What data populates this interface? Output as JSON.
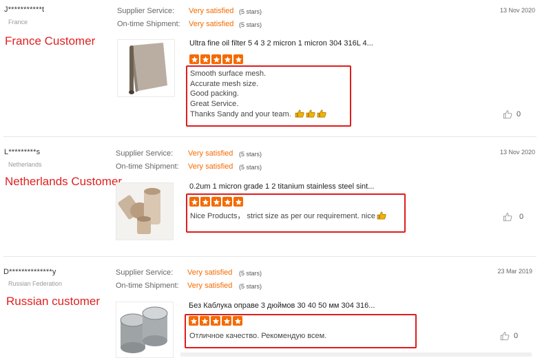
{
  "labels": {
    "supplier_service": "Supplier Service:",
    "ontime_shipment": "On-time Shipment:"
  },
  "reviews": [
    {
      "buyer": "J***********t",
      "country": "France",
      "tag": "France Customer",
      "supplier_value": "Very satisfied",
      "supplier_stars": "(5 stars)",
      "shipment_value": "Very satisfied",
      "shipment_stars": "(5 stars)",
      "date": "13 Nov 2020",
      "product": "Ultra fine oil filter 5 4 3 2 micron 1 micron 304 316L 4...",
      "rating": 5,
      "comment_lines": [
        "Smooth surface mesh.",
        "Accurate mesh size.",
        "Good packing.",
        "Great Service.",
        "Thanks Sandy and your team."
      ],
      "thumbs": 3,
      "likes": "0"
    },
    {
      "buyer": "L*********s",
      "country": "Netherlands",
      "tag": "Netherlands Customer",
      "supplier_value": "Very satisfied",
      "supplier_stars": "(5 stars)",
      "shipment_value": "Very satisfied",
      "shipment_stars": "(5 stars)",
      "date": "13 Nov 2020",
      "product": "0.2um 1 micron grade 1 2 titanium stainless steel sint...",
      "rating": 5,
      "comment_lines": [
        "Nice Products，   strict size as per our requirement. nice"
      ],
      "thumbs": 1,
      "likes": "0"
    },
    {
      "buyer": "D**************y",
      "country": "Russian Federation",
      "tag": "Russian customer",
      "supplier_value": "Very satisfied",
      "supplier_stars": "(5 stars)",
      "shipment_value": "Very satisfied",
      "shipment_stars": "(5 stars)",
      "date": "23 Mar 2019",
      "product": "Без Каблука оправе 3 дюймов 30 40 50 мм 304 316...",
      "rating": 5,
      "comment_lines": [
        "Отличное качество. Рекомендую всем."
      ],
      "thumbs": 0,
      "likes": "0"
    }
  ],
  "colors": {
    "accent": "#f56a00",
    "highlight_box": "#e01b1b",
    "tag_text": "#e02020"
  },
  "icons": {
    "rating": "star-icon",
    "like": "thumbs-up-outline-icon",
    "emoji": "thumbs-up-emoji-icon"
  }
}
